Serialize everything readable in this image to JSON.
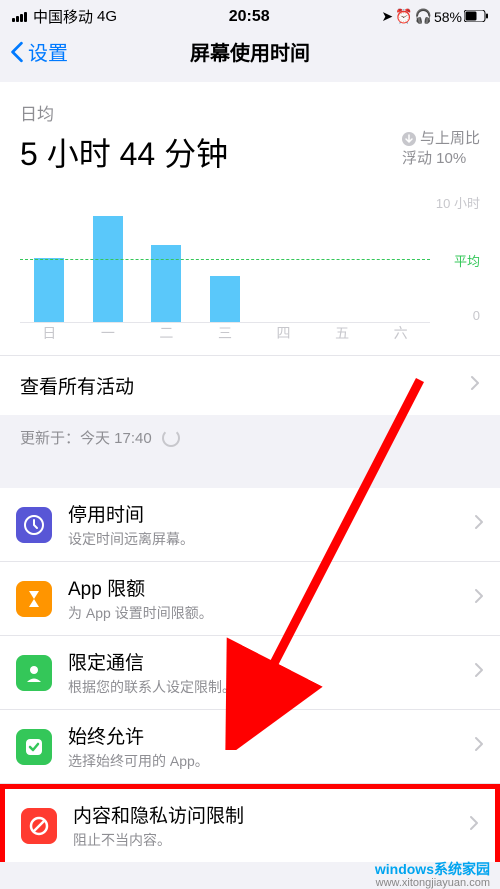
{
  "status": {
    "carrier": "中国移动",
    "network": "4G",
    "time": "20:58",
    "battery_pct": "58%"
  },
  "nav": {
    "back_label": "设置",
    "title": "屏幕使用时间"
  },
  "summary": {
    "avg_label": "日均",
    "time_value": "5 小时 44 分钟",
    "compare_label": "与上周比",
    "compare_value": "浮动 10%"
  },
  "chart_data": {
    "type": "bar",
    "categories": [
      "日",
      "一",
      "二",
      "三",
      "四",
      "五",
      "六"
    ],
    "values": [
      5.0,
      8.2,
      6.0,
      3.6,
      0,
      0,
      0
    ],
    "ylim": [
      0,
      10
    ],
    "avg_line": 5.7,
    "y_top_label": "10 小时",
    "y_bottom_label": "0",
    "avg_label": "平均"
  },
  "rows": {
    "see_all": "查看所有活动",
    "updated_prefix": "更新于：",
    "updated_time": "今天 17:40"
  },
  "menu": [
    {
      "title": "停用时间",
      "sub": "设定时间远离屏幕。",
      "icon_color": "#5856d6",
      "icon": "downtime"
    },
    {
      "title": "App 限额",
      "sub": "为 App 设置时间限额。",
      "icon_color": "#ff9500",
      "icon": "hourglass"
    },
    {
      "title": "限定通信",
      "sub": "根据您的联系人设定限制。",
      "icon_color": "#34c759",
      "icon": "person"
    },
    {
      "title": "始终允许",
      "sub": "选择始终可用的 App。",
      "icon_color": "#34c759",
      "icon": "check"
    },
    {
      "title": "内容和隐私访问限制",
      "sub": "阻止不当内容。",
      "icon_color": "#ff3b30",
      "icon": "nosign"
    }
  ],
  "watermark": {
    "brand": "windows系统家园",
    "url": "www.xitongjiayuan.com"
  }
}
